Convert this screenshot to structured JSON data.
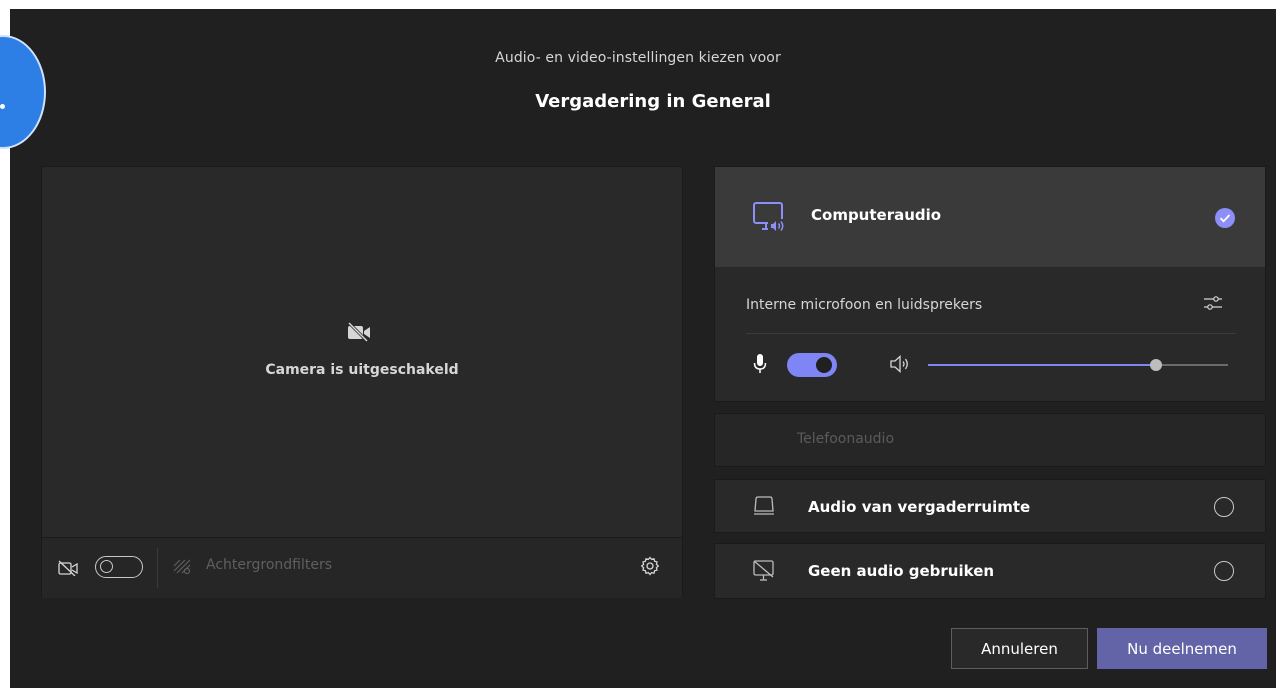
{
  "header": {
    "subtitle": "Audio- en video-instellingen kiezen voor",
    "title": "Vergadering in General"
  },
  "video": {
    "camera_off_text": "Camera is uitgeschakeld",
    "camera_toggle_on": false,
    "background_filters_label": "Achtergrondfilters",
    "icons": {
      "camera_off": "camera-off-icon",
      "background": "background-effects-icon",
      "settings": "gear-icon"
    }
  },
  "audio": {
    "computer": {
      "label": "Computeraudio",
      "selected": true,
      "device_label": "Interne microfoon en luidsprekers",
      "mic_on": true,
      "volume_percent": 76
    },
    "phone": {
      "label": "Telefoonaudio",
      "enabled": false
    },
    "room": {
      "label": "Audio van vergaderruimte",
      "selected": false
    },
    "none": {
      "label": "Geen audio gebruiken",
      "selected": false
    }
  },
  "footer": {
    "cancel_label": "Annuleren",
    "join_label": "Nu deelnemen"
  },
  "colors": {
    "background": "#202020",
    "panel": "#292929",
    "accent": "#7f85f5",
    "join_button": "#6264a7"
  }
}
